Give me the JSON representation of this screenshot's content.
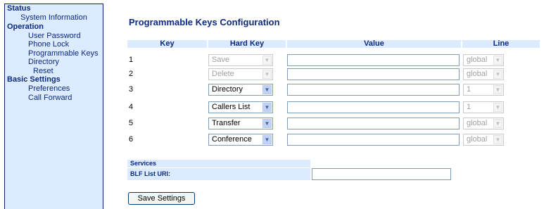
{
  "sidebar": {
    "status": {
      "label": "Status",
      "items": [
        "System Information"
      ]
    },
    "operation": {
      "label": "Operation",
      "items": [
        "User Password",
        "Phone Lock",
        "Programmable Keys",
        "Directory",
        "Reset"
      ]
    },
    "basic": {
      "label": "Basic Settings",
      "items": [
        "Preferences",
        "Call Forward"
      ]
    }
  },
  "main": {
    "title": "Programmable Keys Configuration",
    "columns": {
      "key": "Key",
      "hard_key": "Hard Key",
      "value": "Value",
      "line": "Line"
    },
    "rows": [
      {
        "key": "1",
        "hard_key": "Save",
        "hard_key_disabled": true,
        "value": "",
        "line": "global",
        "line_disabled": true
      },
      {
        "key": "2",
        "hard_key": "Delete",
        "hard_key_disabled": true,
        "value": "",
        "line": "global",
        "line_disabled": true
      },
      {
        "key": "3",
        "hard_key": "Directory",
        "hard_key_disabled": false,
        "value": "",
        "line": "1",
        "line_disabled": true
      },
      {
        "key": "4",
        "hard_key": "Callers List",
        "hard_key_disabled": false,
        "value": "",
        "line": "1",
        "line_disabled": true
      },
      {
        "key": "5",
        "hard_key": "Transfer",
        "hard_key_disabled": false,
        "value": "",
        "line": "global",
        "line_disabled": true
      },
      {
        "key": "6",
        "hard_key": "Conference",
        "hard_key_disabled": false,
        "value": "",
        "line": "global",
        "line_disabled": true
      }
    ],
    "services": {
      "header": "Services",
      "blf_label": "BLF List URI:",
      "blf_value": ""
    },
    "save_label": "Save Settings"
  },
  "icons": {
    "dropdown": "chevron-down-icon"
  },
  "colors": {
    "sidebar_bg": "#dcebff",
    "sidebar_border": "#0a246a",
    "link": "#0b2a80"
  }
}
